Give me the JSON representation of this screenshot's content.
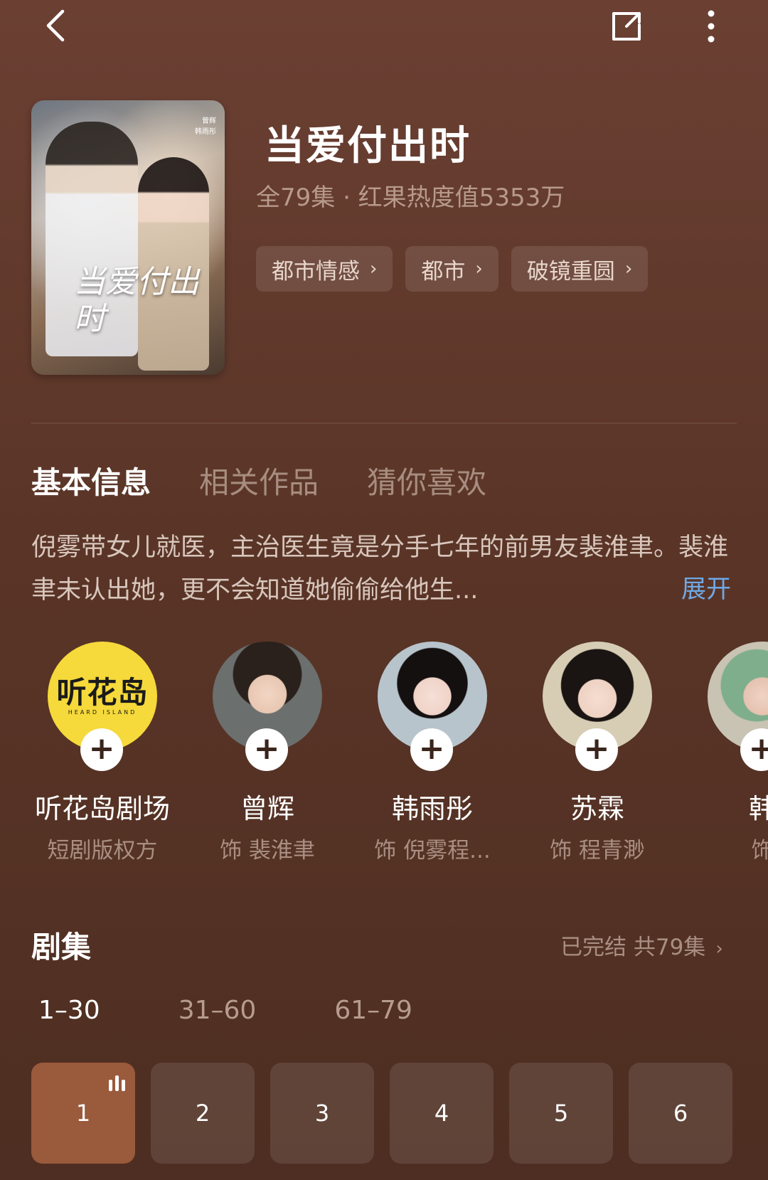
{
  "header": {
    "back_icon": "back-chevron-icon",
    "share_icon": "share-icon",
    "more_icon": "more-vertical-icon"
  },
  "poster": {
    "title": "当爱付出时",
    "credits": [
      "曾辉",
      "韩雨彤"
    ]
  },
  "drama": {
    "title": "当爱付出时",
    "meta": "全79集 · 红果热度值5353万",
    "tags": [
      "都市情感",
      "都市",
      "破镜重圆"
    ]
  },
  "tabs": [
    "基本信息",
    "相关作品",
    "猜你喜欢"
  ],
  "active_tab": "基本信息",
  "synopsis": "倪雾带女儿就医，主治医生竟是分手七年的前男友裴淮聿。裴淮聿未认出她，更不会知道她偷偷给他生...",
  "expand_label": "展开",
  "cast": [
    {
      "name": "听花岛剧场",
      "role": "短剧版权方",
      "logo": "听花岛",
      "logo_sub": "HEARD ISLAND"
    },
    {
      "name": "曾辉",
      "role": "饰 裴淮聿"
    },
    {
      "name": "韩雨彤",
      "role": "饰 倪雾程..."
    },
    {
      "name": "苏霖",
      "role": "饰 程青渺"
    },
    {
      "name": "韩",
      "role": "饰"
    }
  ],
  "episodes": {
    "title": "剧集",
    "status": "已完结 共79集",
    "ranges": [
      "1–30",
      "31–60",
      "61–79"
    ],
    "active_range": "1–30",
    "items": [
      "1",
      "2",
      "3",
      "4",
      "5",
      "6"
    ],
    "playing": "1"
  }
}
